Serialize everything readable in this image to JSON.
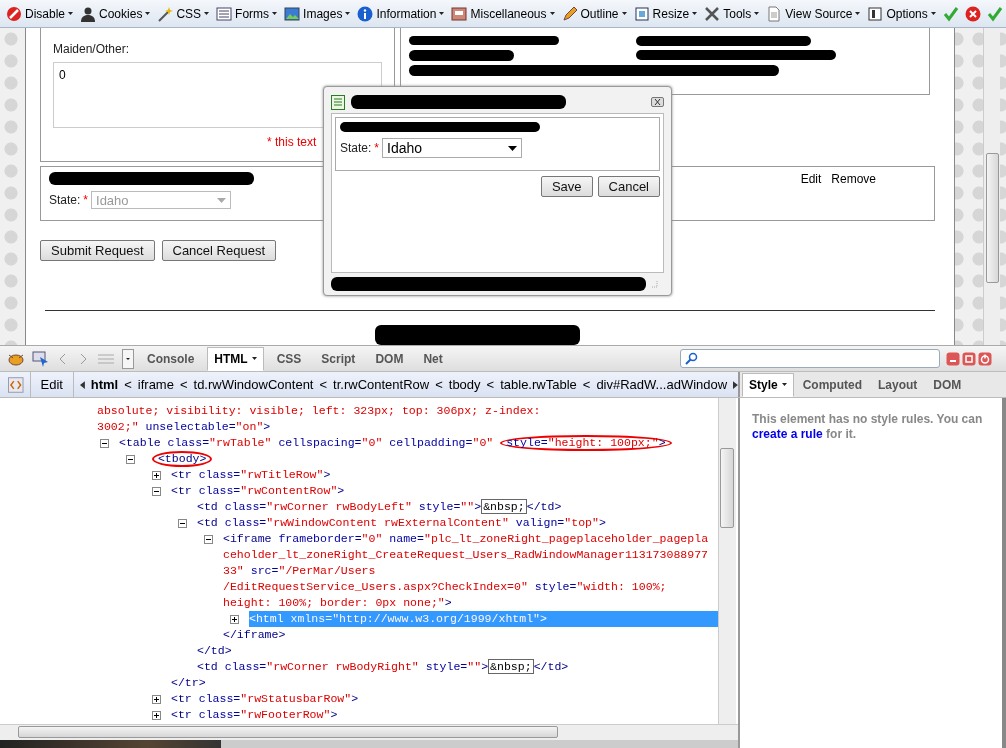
{
  "toolbar": {
    "menus": [
      {
        "label": "Disable"
      },
      {
        "label": "Cookies"
      },
      {
        "label": "CSS"
      },
      {
        "label": "Forms"
      },
      {
        "label": "Images"
      },
      {
        "label": "Information"
      },
      {
        "label": "Miscellaneous"
      },
      {
        "label": "Outline"
      },
      {
        "label": "Resize"
      },
      {
        "label": "Tools"
      },
      {
        "label": "View Source"
      },
      {
        "label": "Options"
      }
    ]
  },
  "page": {
    "maiden_label": "Maiden/Other:",
    "maiden_value": "0",
    "required_note": "* this text",
    "state": {
      "label": "State:",
      "required_mark": "*",
      "value": "Idaho",
      "disabled": true
    },
    "row_links": [
      "Edit",
      "Remove"
    ],
    "buttons": [
      "Submit Request",
      "Cancel Request"
    ]
  },
  "dialog": {
    "state": {
      "label": "State:",
      "required_mark": "*",
      "value": "Idaho",
      "disabled": false
    },
    "buttons": [
      "Save",
      "Cancel"
    ]
  },
  "firebug": {
    "tabs": [
      {
        "label": "Console",
        "selected": false,
        "menu": false
      },
      {
        "label": "HTML",
        "selected": true,
        "menu": true
      },
      {
        "label": "CSS",
        "selected": false,
        "menu": false
      },
      {
        "label": "Script",
        "selected": false,
        "menu": false
      },
      {
        "label": "DOM",
        "selected": false,
        "menu": false
      },
      {
        "label": "Net",
        "selected": false,
        "menu": false
      }
    ],
    "breadcrumb": {
      "edit": "Edit",
      "separator": "<",
      "items": [
        {
          "label": "html",
          "selected": true
        },
        {
          "label": "iframe",
          "selected": false
        },
        {
          "label": "td.rwWindowContent",
          "selected": false
        },
        {
          "label": "tr.rwContentRow",
          "selected": false
        },
        {
          "label": "tbody",
          "selected": false
        },
        {
          "label": "table.rwTable",
          "selected": false
        },
        {
          "label": "div#RadW...adWindow",
          "selected": false
        }
      ]
    },
    "side_tabs": [
      {
        "label": "Style",
        "selected": true,
        "menu": true
      },
      {
        "label": "Computed",
        "selected": false,
        "menu": false
      },
      {
        "label": "Layout",
        "selected": false,
        "menu": false
      },
      {
        "label": "DOM",
        "selected": false,
        "menu": false
      }
    ],
    "style_message": {
      "text": "This element has no style rules. You can",
      "link": "create a rule",
      "suffix": "for it."
    }
  },
  "code": {
    "cut_line": [
      {
        "kind": "value",
        "t": "absolute; visibility: visible; left: 323px; top: 306px; z-index:\n3002;\""
      },
      {
        "kind": "attr",
        "t": " unselectable="
      },
      {
        "kind": "value",
        "t": "\"on\""
      },
      {
        "kind": "tag",
        "t": ">"
      }
    ],
    "tree": [
      {
        "selected": false,
        "expanded": true,
        "open": [
          {
            "kind": "tag",
            "t": "<table"
          },
          {
            "kind": "attr",
            "t": " class="
          },
          {
            "kind": "value",
            "t": "\"rwTable\""
          },
          {
            "kind": "attr",
            "t": " cellspacing="
          },
          {
            "kind": "value",
            "t": "\"0\""
          },
          {
            "kind": "attr",
            "t": " cellpadding="
          },
          {
            "kind": "value",
            "t": "\"0\""
          },
          {
            "kind": "circle",
            "tokens": [
              {
                "kind": "attr",
                "t": "style="
              },
              {
                "kind": "value",
                "t": "\"height: 100px;\""
              },
              {
                "kind": "tag",
                "t": ">"
              }
            ]
          }
        ],
        "children": [
          {
            "selected": false,
            "expanded": true,
            "open": [
              {
                "kind": "circle",
                "tokens": [
                  {
                    "kind": "tag",
                    "t": "<tbody>"
                  }
                ]
              }
            ],
            "children": [
              {
                "selected": false,
                "expanded": false,
                "open": [
                  {
                    "kind": "tag",
                    "t": "<tr"
                  },
                  {
                    "kind": "attr",
                    "t": " class="
                  },
                  {
                    "kind": "value",
                    "t": "\"rwTitleRow\""
                  },
                  {
                    "kind": "tag",
                    "t": ">"
                  }
                ]
              },
              {
                "selected": false,
                "expanded": true,
                "open": [
                  {
                    "kind": "tag",
                    "t": "<tr"
                  },
                  {
                    "kind": "attr",
                    "t": " class="
                  },
                  {
                    "kind": "value",
                    "t": "\"rwContentRow\""
                  },
                  {
                    "kind": "tag",
                    "t": ">"
                  }
                ],
                "close": [
                  {
                    "kind": "tag",
                    "t": "</tr>"
                  }
                ],
                "children": [
                  {
                    "selected": false,
                    "open": [
                      {
                        "kind": "tag",
                        "t": "<td"
                      },
                      {
                        "kind": "attr",
                        "t": " class="
                      },
                      {
                        "kind": "value",
                        "t": "\"rwCorner rwBodyLeft\""
                      },
                      {
                        "kind": "attr",
                        "t": " style="
                      },
                      {
                        "kind": "value",
                        "t": "\"\""
                      },
                      {
                        "kind": "tag",
                        "t": ">"
                      },
                      {
                        "kind": "entity",
                        "t": "&nbsp;"
                      },
                      {
                        "kind": "tag",
                        "t": "</td>"
                      }
                    ]
                  },
                  {
                    "selected": false,
                    "expanded": true,
                    "open": [
                      {
                        "kind": "tag",
                        "t": "<td"
                      },
                      {
                        "kind": "attr",
                        "t": " class="
                      },
                      {
                        "kind": "value",
                        "t": "\"rwWindowContent rwExternalContent\""
                      },
                      {
                        "kind": "attr",
                        "t": " valign="
                      },
                      {
                        "kind": "value",
                        "t": "\"top\""
                      },
                      {
                        "kind": "tag",
                        "t": ">"
                      }
                    ],
                    "close": [
                      {
                        "kind": "tag",
                        "t": "</td>"
                      }
                    ],
                    "children": [
                      {
                        "selected": false,
                        "expanded": true,
                        "open": [
                          {
                            "kind": "tag",
                            "t": "<iframe"
                          },
                          {
                            "kind": "attr",
                            "t": " frameborder="
                          },
                          {
                            "kind": "value",
                            "t": "\"0\""
                          },
                          {
                            "kind": "attr",
                            "t": " name="
                          },
                          {
                            "kind": "value",
                            "t": "\"plc_lt_zoneRight_pageplaceholder_pageplaceholder_lt_zoneRight_CreateRequest_Users_RadWindowManager11317308897733\""
                          },
                          {
                            "kind": "attr",
                            "t": " src="
                          },
                          {
                            "kind": "value",
                            "t": "\"/PerMar/Users\n/EditRequestService_Users.aspx?CheckIndex=0\""
                          },
                          {
                            "kind": "attr",
                            "t": " style="
                          },
                          {
                            "kind": "value",
                            "t": "\"width: 100%;\nheight: 100%; border: 0px none;\""
                          },
                          {
                            "kind": "tag",
                            "t": ">"
                          }
                        ],
                        "close": [
                          {
                            "kind": "tag",
                            "t": "</iframe>"
                          }
                        ],
                        "children": [
                          {
                            "selected": true,
                            "expanded": false,
                            "open": [
                              {
                                "kind": "tag",
                                "t": "<html"
                              },
                              {
                                "kind": "attr",
                                "t": " xmlns="
                              },
                              {
                                "kind": "value",
                                "t": "\"http://www.w3.org/1999/xhtml\""
                              },
                              {
                                "kind": "tag",
                                "t": ">"
                              }
                            ]
                          }
                        ]
                      }
                    ]
                  },
                  {
                    "selected": false,
                    "open": [
                      {
                        "kind": "tag",
                        "t": "<td"
                      },
                      {
                        "kind": "attr",
                        "t": " class="
                      },
                      {
                        "kind": "value",
                        "t": "\"rwCorner rwBodyRight\""
                      },
                      {
                        "kind": "attr",
                        "t": " style="
                      },
                      {
                        "kind": "value",
                        "t": "\"\""
                      },
                      {
                        "kind": "tag",
                        "t": ">"
                      },
                      {
                        "kind": "entity",
                        "t": "&nbsp;"
                      },
                      {
                        "kind": "tag",
                        "t": "</td>"
                      }
                    ]
                  }
                ]
              },
              {
                "selected": false,
                "expanded": false,
                "open": [
                  {
                    "kind": "tag",
                    "t": "<tr"
                  },
                  {
                    "kind": "attr",
                    "t": " class="
                  },
                  {
                    "kind": "value",
                    "t": "\"rwStatusbarRow\""
                  },
                  {
                    "kind": "tag",
                    "t": ">"
                  }
                ]
              },
              {
                "selected": false,
                "expanded": false,
                "open": [
                  {
                    "kind": "tag",
                    "t": "<tr"
                  },
                  {
                    "kind": "attr",
                    "t": " class="
                  },
                  {
                    "kind": "value",
                    "t": "\"rwFooterRow\""
                  },
                  {
                    "kind": "tag",
                    "t": ">"
                  }
                ]
              }
            ]
          }
        ]
      }
    ]
  }
}
